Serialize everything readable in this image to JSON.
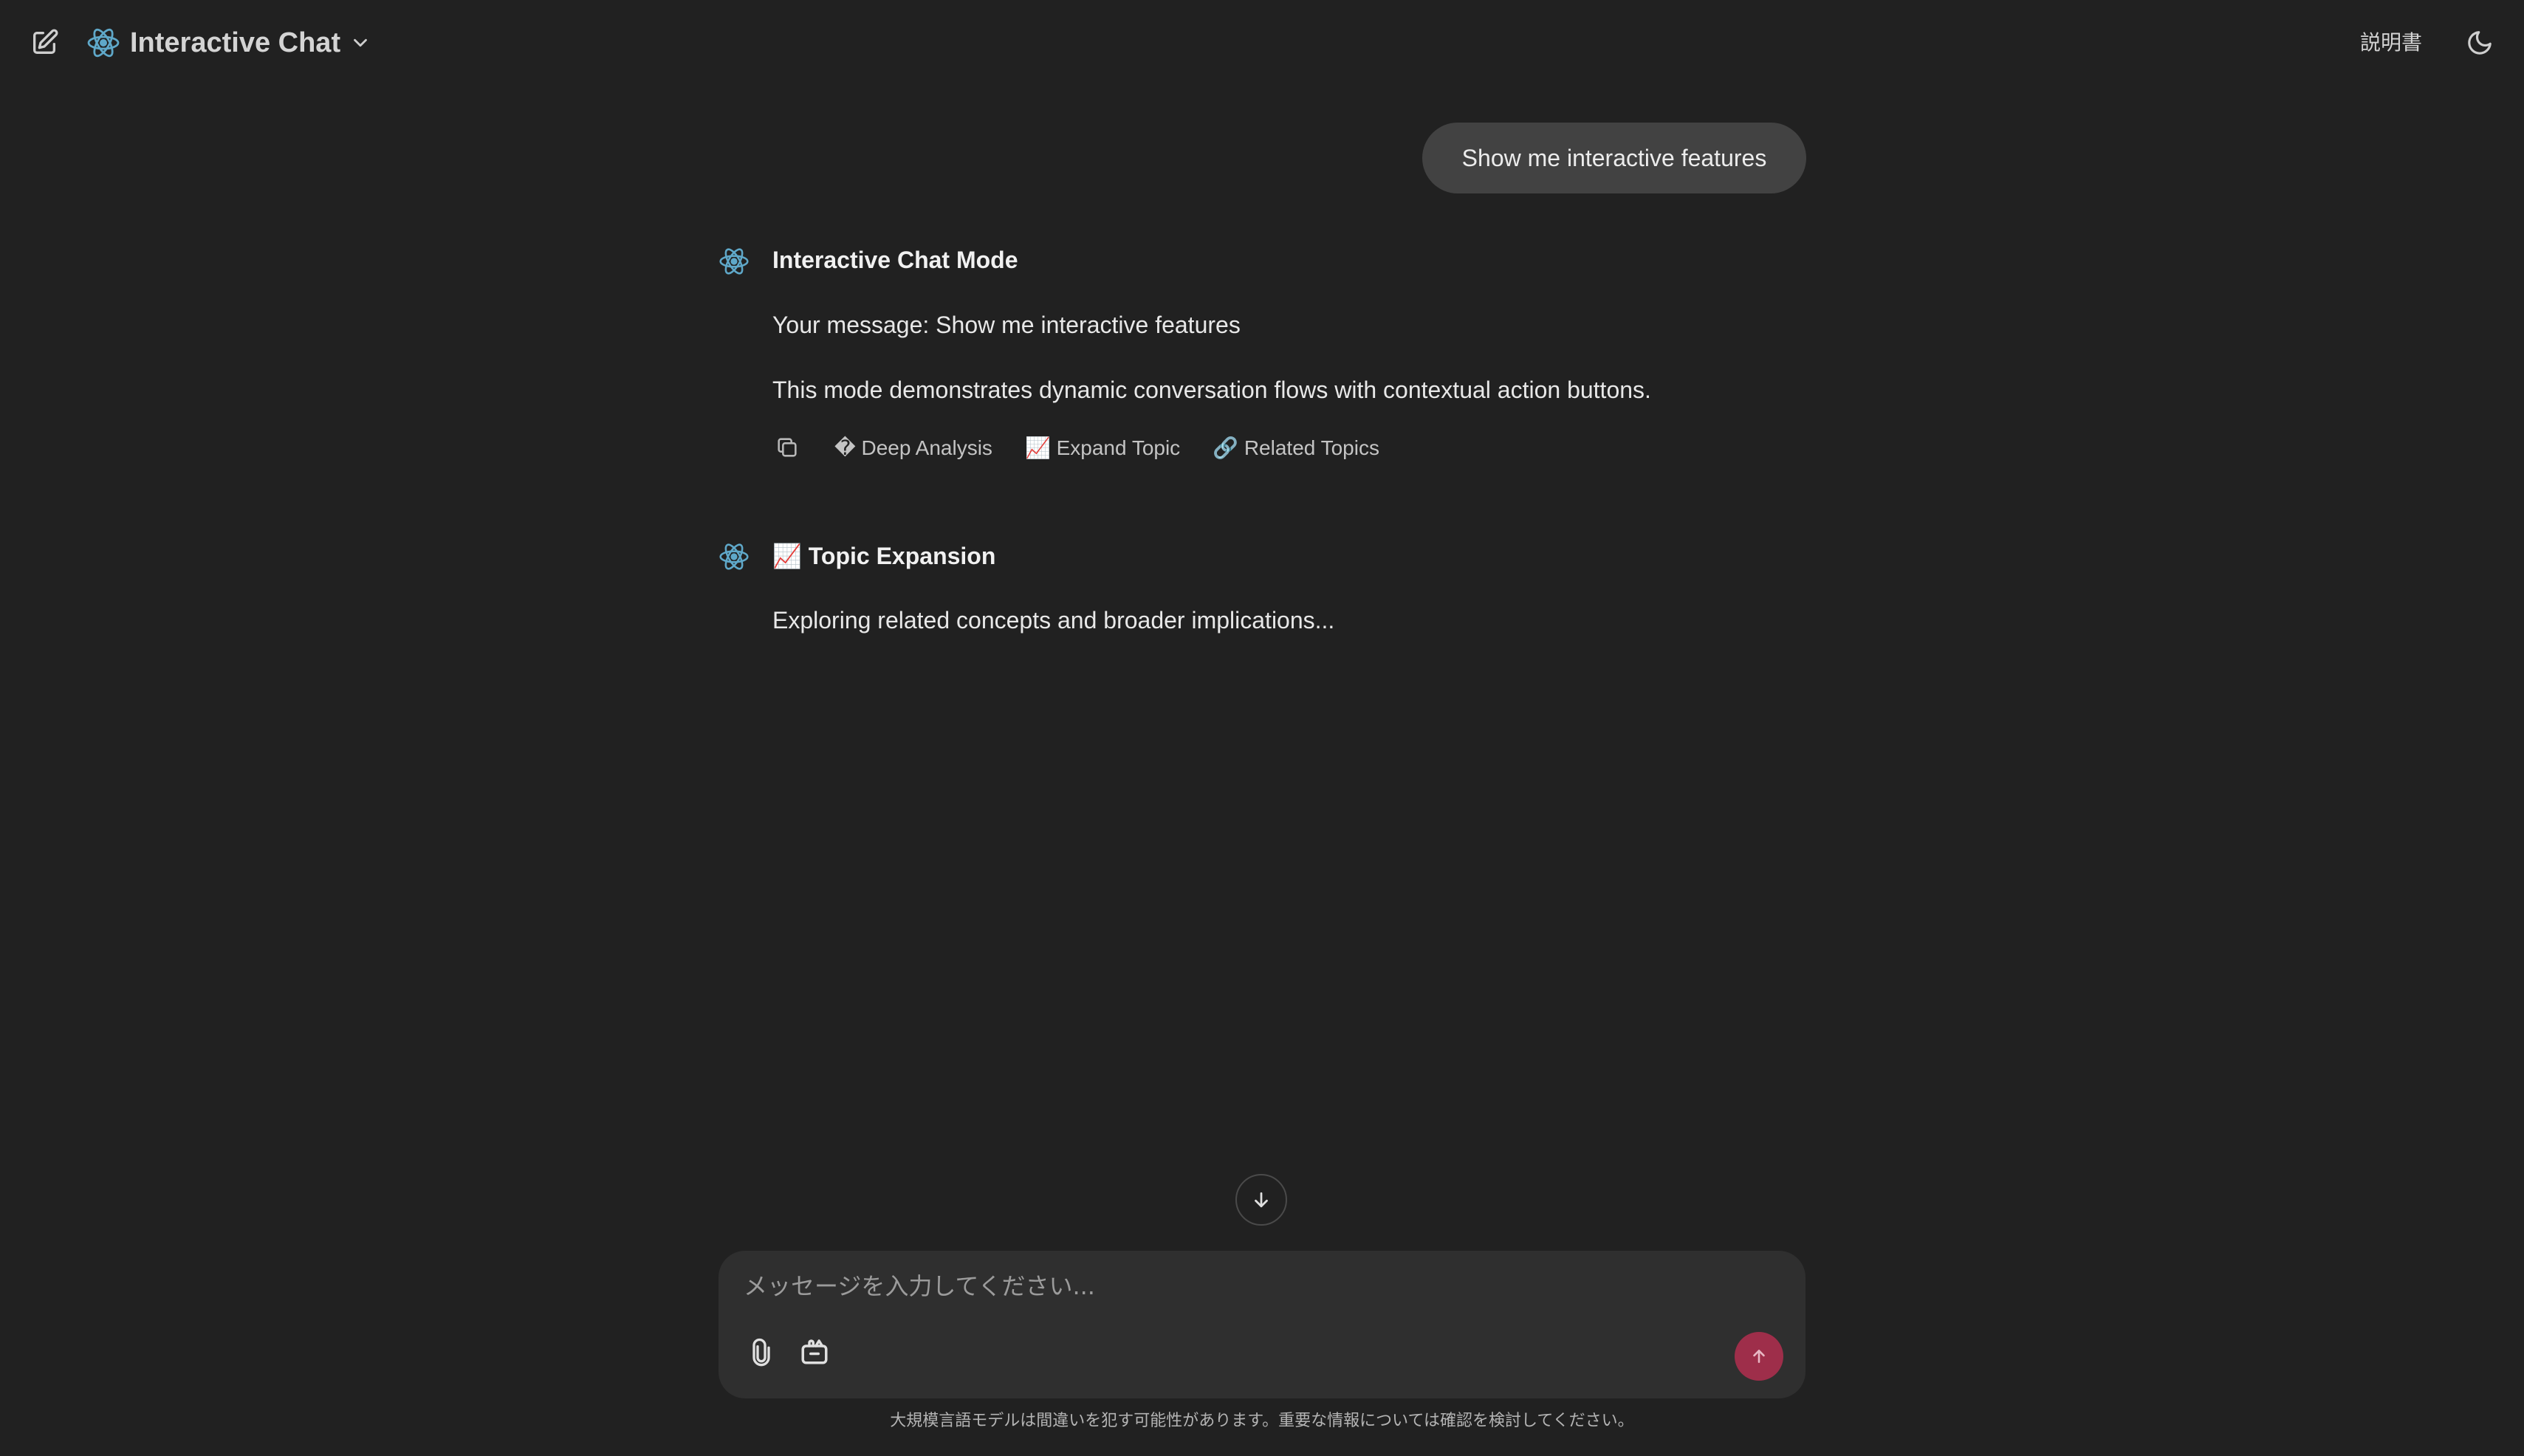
{
  "header": {
    "title": "Interactive Chat",
    "manual_label": "説明書",
    "icons": {
      "edit": "edit-icon",
      "logo": "atom-icon",
      "dropdown": "chevron-down-icon",
      "theme": "moon-icon"
    }
  },
  "conversation": {
    "user_message": "Show me interactive features",
    "messages": [
      {
        "title": "Interactive Chat Mode",
        "lines": [
          "Your message: Show me interactive features",
          "This mode demonstrates dynamic conversation flows with contextual action buttons."
        ],
        "actions": [
          {
            "label": "� Deep Analysis"
          },
          {
            "label": "📈 Expand Topic"
          },
          {
            "label": "🔗 Related Topics"
          }
        ]
      },
      {
        "title": "📈 Topic Expansion",
        "lines": [
          "Exploring related concepts and broader implications..."
        ]
      }
    ]
  },
  "composer": {
    "placeholder": "メッセージを入力してください...",
    "value": ""
  },
  "footer": {
    "disclaimer": "大規模言語モデルは間違いを犯す可能性があります。重要な情報については確認を検討してください。"
  },
  "colors": {
    "background": "#212121",
    "bubble": "#424242",
    "composer": "#2f2f2f",
    "send_button": "#9e2e4a",
    "logo_accent": "#5fa8c9"
  }
}
